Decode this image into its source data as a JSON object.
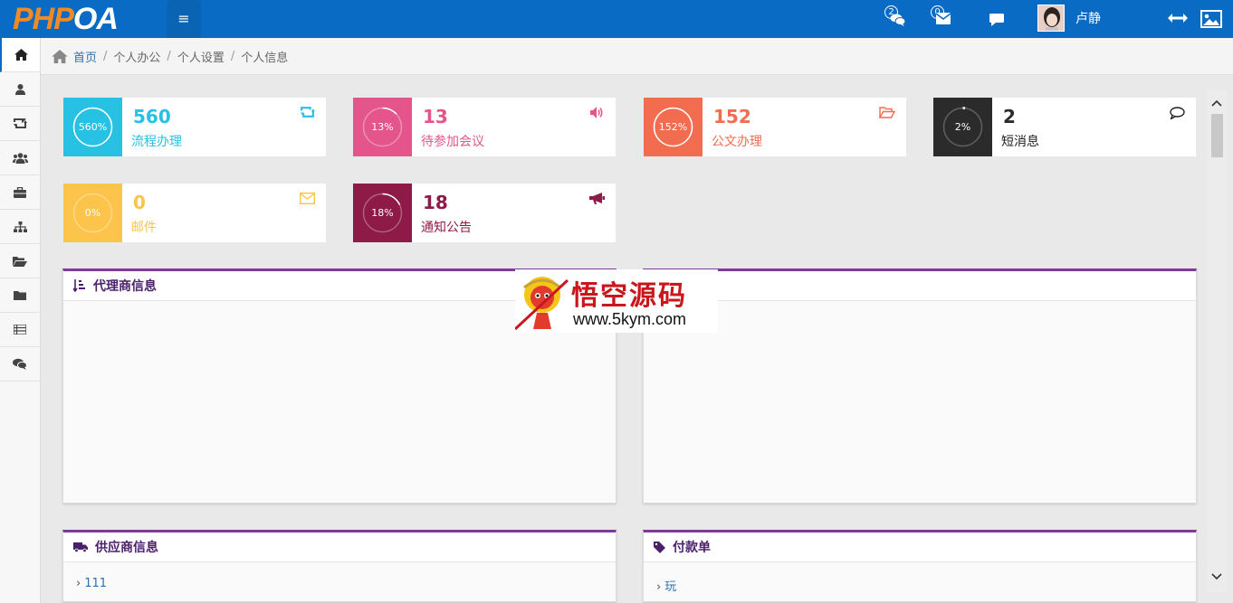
{
  "header": {
    "logo_php": "PHP",
    "logo_oa": "OA",
    "menu_toggle": "≡",
    "notifications": [
      {
        "icon": "comments-icon",
        "count": "2"
      },
      {
        "icon": "envelope-icon",
        "count": "0"
      },
      {
        "icon": "comment-icon",
        "count": ""
      }
    ],
    "username": "卢静",
    "right_icons": [
      "arrows-h-icon",
      "picture-icon"
    ]
  },
  "sidebar": {
    "items": [
      {
        "icon": "home-icon",
        "active": true
      },
      {
        "icon": "user-icon"
      },
      {
        "icon": "retweet-icon"
      },
      {
        "icon": "users-icon"
      },
      {
        "icon": "briefcase-icon"
      },
      {
        "icon": "sitemap-icon"
      },
      {
        "icon": "folder-open-icon"
      },
      {
        "icon": "folder-icon"
      },
      {
        "icon": "list-icon"
      },
      {
        "icon": "comments-icon"
      }
    ]
  },
  "breadcrumb": {
    "home": "首页",
    "items": [
      "个人办公",
      "个人设置",
      "个人信息"
    ],
    "separator": "/"
  },
  "stats": [
    {
      "percent": "560%",
      "number": "560",
      "label": "流程办理",
      "color": "#27c1e3",
      "icon": "retweet-icon",
      "fill": 1.0
    },
    {
      "percent": "13%",
      "number": "13",
      "label": "待参加会议",
      "color": "#e4558b",
      "icon": "volume-up-icon",
      "fill": 0.13
    },
    {
      "percent": "152%",
      "number": "152",
      "label": "公文办理",
      "color": "#f26c4f",
      "icon": "folder-open-icon",
      "fill": 1.0
    },
    {
      "percent": "2%",
      "number": "2",
      "label": "短消息",
      "color": "#2b2b2b",
      "icon": "comment-icon",
      "fill": 0.02
    },
    {
      "percent": "0%",
      "number": "0",
      "label": "邮件",
      "color": "#fcc44a",
      "icon": "envelope-icon",
      "fill": 0.0
    },
    {
      "percent": "18%",
      "number": "18",
      "label": "通知公告",
      "color": "#8e1a47",
      "icon": "bullhorn-icon",
      "fill": 0.18
    }
  ],
  "panels": [
    {
      "title": "代理商信息",
      "icon": "sort-amount-icon",
      "rows": []
    },
    {
      "title": "",
      "icon": "",
      "rows": []
    },
    {
      "title": "供应商信息",
      "icon": "truck-icon",
      "rows": [
        "111"
      ]
    },
    {
      "title": "付款单",
      "icon": "tag-icon",
      "rows": [
        "玩"
      ]
    }
  ],
  "watermark": {
    "title": "悟空源码",
    "url": "www.5kym.com"
  },
  "colors": {
    "topbar": "#0a6bc4",
    "accent_purple": "#7d3c98"
  }
}
